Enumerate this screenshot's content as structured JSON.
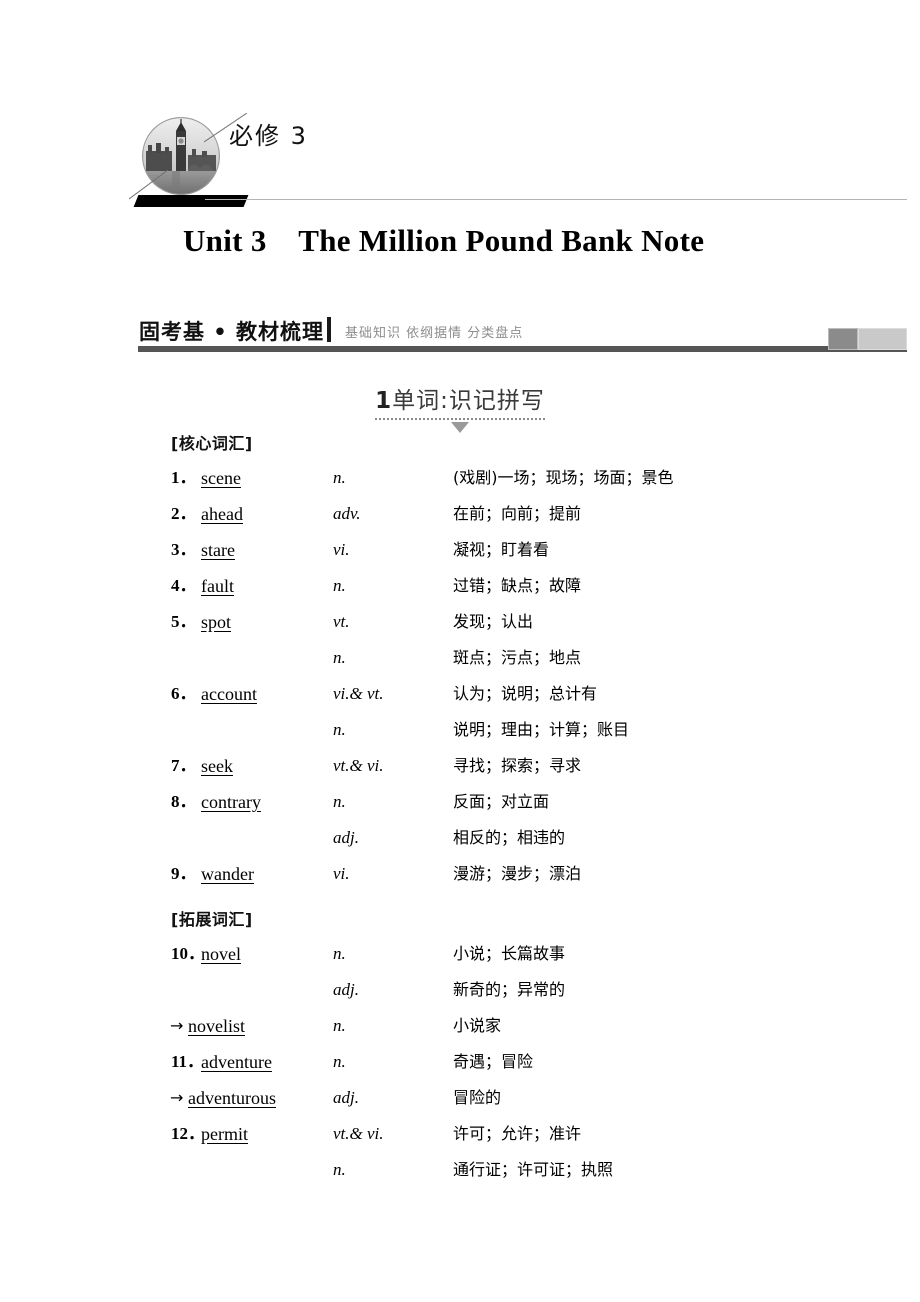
{
  "masthead": {
    "volume_label": "必修 3",
    "badge_icon": "big-ben-photo-icon"
  },
  "chapter": {
    "title": "Unit 3    The Million Pound Bank Note"
  },
  "section_band": {
    "title": "固考基 • 教材梳理",
    "subtitle": "基础知识  依纲据情  分类盘点"
  },
  "subsection": {
    "number": "1",
    "label": "单词:识记拼写"
  },
  "vocab": {
    "core_group_title": "[核心词汇]",
    "extend_group_title": "[拓展词汇]",
    "core_entries": [
      {
        "num": "1．",
        "word": "scene",
        "pos": "n.",
        "def": "(戏剧)一场；现场；场面；景色"
      },
      {
        "num": "",
        "word": "",
        "pos": "",
        "def": ""
      },
      {
        "num": "2．",
        "word": "ahead",
        "pos": "adv.",
        "def": "在前；向前；提前"
      },
      {
        "num": "3．",
        "word": "stare",
        "pos": "vi.",
        "def": "凝视；盯着看"
      },
      {
        "num": "4．",
        "word": "fault",
        "pos": "n.",
        "def": "过错；缺点；故障"
      },
      {
        "num": "5．",
        "word": "spot",
        "pos": "vt.",
        "def": "发现；认出"
      },
      {
        "num": "",
        "word": "",
        "pos": "n.",
        "def": "斑点；污点；地点"
      },
      {
        "num": "6．",
        "word": "account",
        "pos": "vi.& vt.",
        "def": "认为；说明；总计有"
      },
      {
        "num": "",
        "word": "",
        "pos": "n.",
        "def": "说明；理由；计算；账目"
      },
      {
        "num": "7．",
        "word": "seek",
        "pos": "vt.& vi.",
        "def": "寻找；探索；寻求"
      },
      {
        "num": "8．",
        "word": "contrary",
        "pos": "n.",
        "def": "反面；对立面"
      },
      {
        "num": "",
        "word": "",
        "pos": "adj.",
        "def": "相反的；相违的"
      },
      {
        "num": "9．",
        "word": "wander",
        "pos": "vi.",
        "def": "漫游；漫步；漂泊"
      }
    ],
    "extend_entries": [
      {
        "num": "10．",
        "arrow": "",
        "word": "novel",
        "pos": "n.",
        "def": "小说；长篇故事"
      },
      {
        "num": "",
        "arrow": "",
        "word": "",
        "pos": "adj.",
        "def": "新奇的；异常的"
      },
      {
        "num": "",
        "arrow": "→",
        "word": "novelist",
        "pos": "n.",
        "def": "小说家"
      },
      {
        "num": "11．",
        "arrow": "",
        "word": "adventure",
        "pos": "n.",
        "def": "奇遇；冒险"
      },
      {
        "num": "",
        "arrow": "→",
        "word": "adventurous",
        "pos": "adj.",
        "def": "冒险的"
      },
      {
        "num": "12．",
        "arrow": "",
        "word": "permit",
        "pos": "vt.& vi.",
        "def": "许可；允许；准许"
      },
      {
        "num": "",
        "arrow": "",
        "word": "",
        "pos": "n.",
        "def": "通行证；许可证；执照"
      }
    ]
  },
  "colors": {
    "band_underline": "#555555",
    "band_subtitle": "#8d8d8d",
    "chip_dark": "#8b8b8b",
    "chip_light": "#c9c9c9",
    "rule_line": "#b5b5b5"
  }
}
